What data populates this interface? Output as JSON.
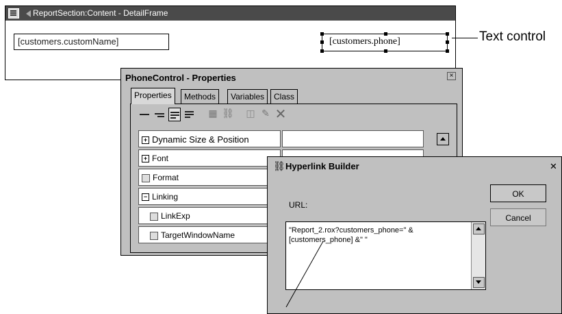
{
  "report": {
    "title": "ReportSection:Content - DetailFrame",
    "field_name": "[customers.customName]",
    "field_phone": "[customers.phone]"
  },
  "callout": {
    "label": "Text control"
  },
  "properties_window": {
    "title": "PhoneControl - Properties",
    "tabs": [
      "Properties",
      "Methods",
      "Variables",
      "Class"
    ],
    "rows": [
      {
        "label": "Dynamic Size & Position",
        "marker": "+"
      },
      {
        "label": "Font",
        "marker": "+"
      },
      {
        "label": "Format",
        "marker": ""
      },
      {
        "label": "Linking",
        "marker": "−"
      },
      {
        "label": "LinkExp",
        "marker": ""
      },
      {
        "label": "TargetWindowName",
        "marker": ""
      }
    ],
    "toolbar_icons": [
      "align-left-icon",
      "align-center-icon",
      "align-right-icon",
      "justify-icon",
      "grid-icon",
      "hyperlink-icon",
      "paste-icon",
      "edit-icon",
      "delete-icon"
    ]
  },
  "hyperlink_builder": {
    "title": "Hyperlink Builder",
    "url_label": "URL:",
    "url_value_line1": "\"Report_2.rox?customers_phone=\" &",
    "url_value_line2": "[customers_phone] &\" \"",
    "ok_label": "OK",
    "cancel_label": "Cancel"
  }
}
